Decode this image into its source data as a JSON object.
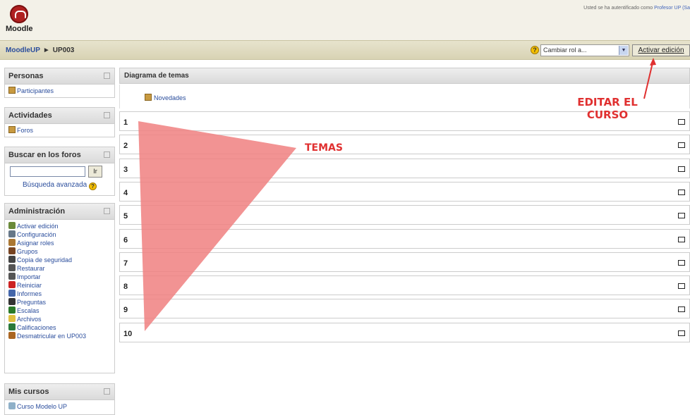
{
  "header": {
    "logo_text": "Moodle",
    "login_text": "Usted se ha autentificado como",
    "login_user": "Profesor UP (Sa"
  },
  "navbar": {
    "breadcrumb_site": "MoodleUP",
    "breadcrumb_sep": "►",
    "breadcrumb_course": "UP003",
    "role_select_value": "Cambiar rol a...",
    "edit_button": "Activar edición"
  },
  "blocks": {
    "personas": {
      "title": "Personas",
      "items": [
        {
          "label": "Participantes",
          "icon": "users-icon"
        }
      ]
    },
    "actividades": {
      "title": "Actividades",
      "items": [
        {
          "label": "Foros",
          "icon": "forum-icon"
        }
      ]
    },
    "buscar": {
      "title": "Buscar en los foros",
      "go_button": "Ir",
      "advanced_link": "Búsqueda avanzada",
      "help_glyph": "?"
    },
    "administracion": {
      "title": "Administración",
      "items": [
        {
          "label": "Activar edición",
          "icon": "edit-icon"
        },
        {
          "label": "Configuración",
          "icon": "settings-icon"
        },
        {
          "label": "Asignar roles",
          "icon": "roles-icon"
        },
        {
          "label": "Grupos",
          "icon": "groups-icon"
        },
        {
          "label": "Copia de seguridad",
          "icon": "backup-icon"
        },
        {
          "label": "Restaurar",
          "icon": "restore-icon"
        },
        {
          "label": "Importar",
          "icon": "import-icon"
        },
        {
          "label": "Reiniciar",
          "icon": "reset-icon"
        },
        {
          "label": "Informes",
          "icon": "reports-icon"
        },
        {
          "label": "Preguntas",
          "icon": "questions-icon"
        },
        {
          "label": "Escalas",
          "icon": "scales-icon"
        },
        {
          "label": "Archivos",
          "icon": "folder-icon"
        },
        {
          "label": "Calificaciones",
          "icon": "grades-icon"
        },
        {
          "label": "Desmatricular en UP003",
          "icon": "unenrol-icon"
        }
      ]
    },
    "mis_cursos": {
      "title": "Mis cursos",
      "items": [
        {
          "label": "Curso Modelo UP",
          "icon": "course-icon"
        }
      ]
    }
  },
  "main": {
    "title": "Diagrama de temas",
    "news_link": "Novedades",
    "topics": [
      "1",
      "2",
      "3",
      "4",
      "5",
      "6",
      "7",
      "8",
      "9",
      "10"
    ]
  },
  "annotations": {
    "temas": "TEMAS",
    "editar_line1": "EDITAR EL",
    "editar_line2": "CURSO",
    "color": "#e03030"
  },
  "colors": {
    "link": "#2a4d9c",
    "navbar": "#e2ddc3",
    "annotation_fill": "#f08080"
  }
}
